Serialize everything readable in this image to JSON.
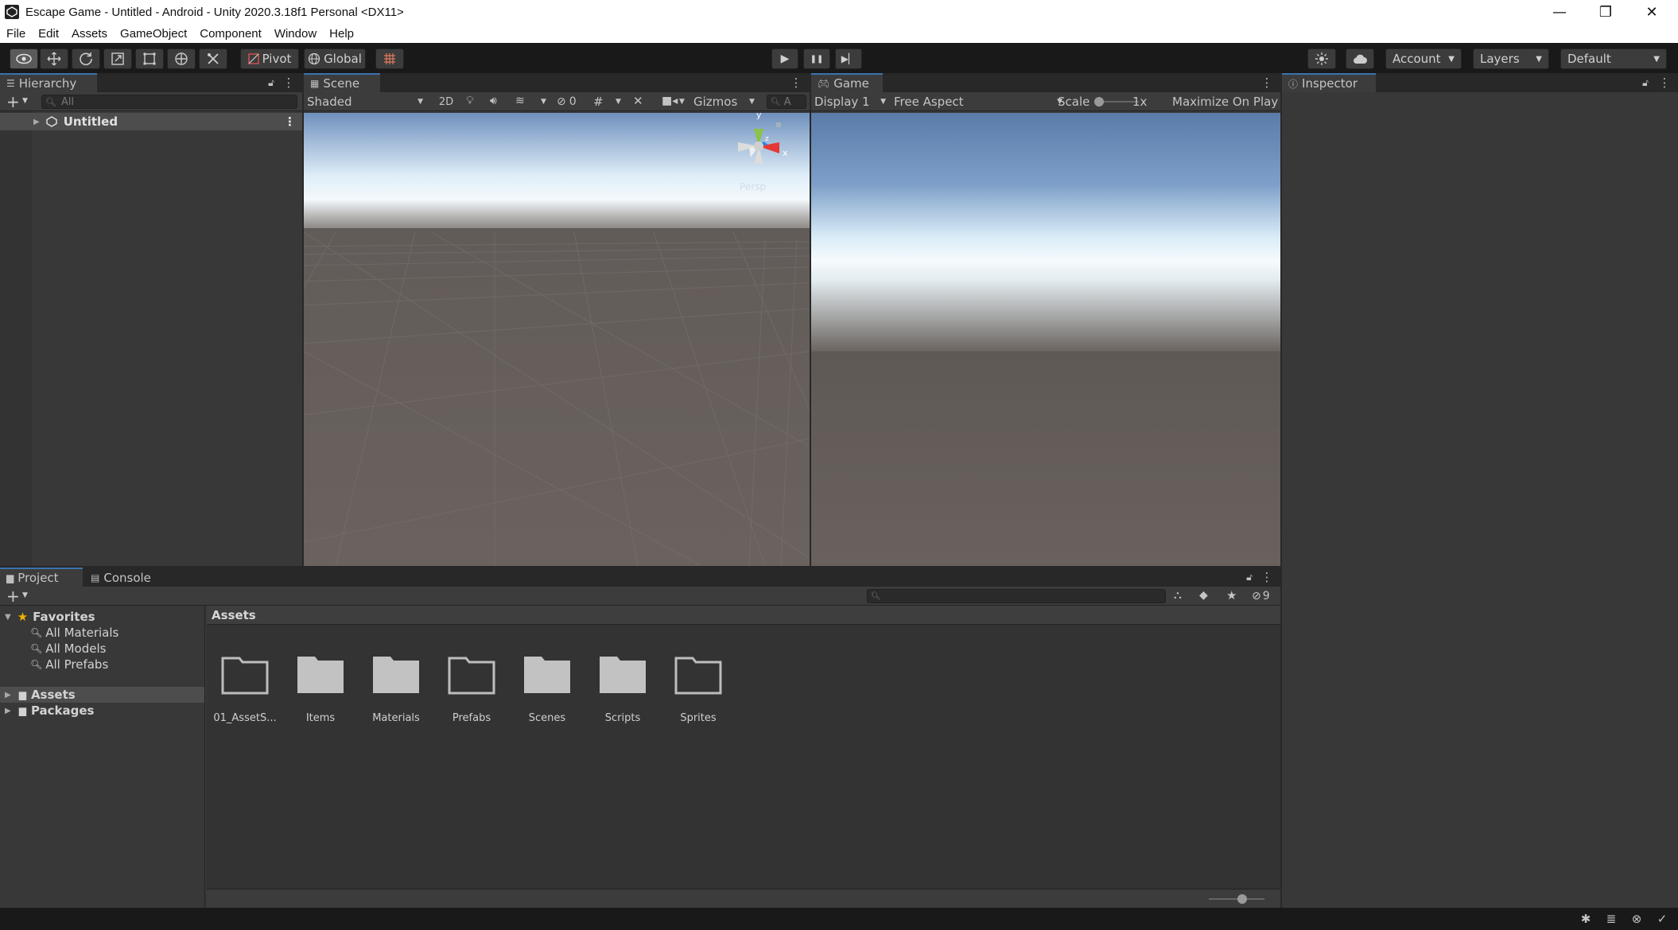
{
  "window": {
    "title": "Escape Game - Untitled - Android - Unity 2020.3.18f1 Personal <DX11>",
    "controls": {
      "minimize": "—",
      "restore": "❐",
      "close": "✕"
    }
  },
  "menu": [
    "File",
    "Edit",
    "Assets",
    "GameObject",
    "Component",
    "Window",
    "Help"
  ],
  "toolbar": {
    "pivot_label": "Pivot",
    "global_label": "Global",
    "account_label": "Account",
    "layers_label": "Layers",
    "layout_label": "Default",
    "play_icon": "▶",
    "pause_icon": "❚❚",
    "step_icon": "▶▏"
  },
  "hierarchy": {
    "tab_label": "Hierarchy",
    "search_placeholder": "All",
    "root_item": "Untitled"
  },
  "scene": {
    "tab_label": "Scene",
    "shading_mode": "Shaded",
    "mode_2d": "2D",
    "hidden_count": "0",
    "gizmos_label": "Gizmos",
    "search_text": "A",
    "gizmo_axes": {
      "y": "y",
      "x": "x",
      "z": "z"
    },
    "projection_label": "Persp"
  },
  "game": {
    "tab_label": "Game",
    "display": "Display 1",
    "aspect": "Free Aspect",
    "scale_label": "Scale",
    "scale_value": "1x",
    "maximize_label": "Maximize On Play"
  },
  "inspector": {
    "tab_label": "Inspector"
  },
  "project": {
    "tab_label": "Project",
    "console_tab_label": "Console",
    "hidden_count": "9",
    "favorites_label": "Favorites",
    "favorites": [
      "All Materials",
      "All Models",
      "All Prefabs"
    ],
    "roots": [
      "Assets",
      "Packages"
    ],
    "breadcrumb": "Assets",
    "folders": [
      "01_AssetS...",
      "Items",
      "Materials",
      "Prefabs",
      "Scenes",
      "Scripts",
      "Sprites"
    ]
  },
  "colors": {
    "accent": "#3a72b0",
    "panel_bg": "#383838",
    "toolbar_bg": "#191919",
    "sky_top": "#5d7fae",
    "horizon": "#f2f8fc",
    "ground": "#6a635f",
    "favorite_star": "#f0b400"
  }
}
